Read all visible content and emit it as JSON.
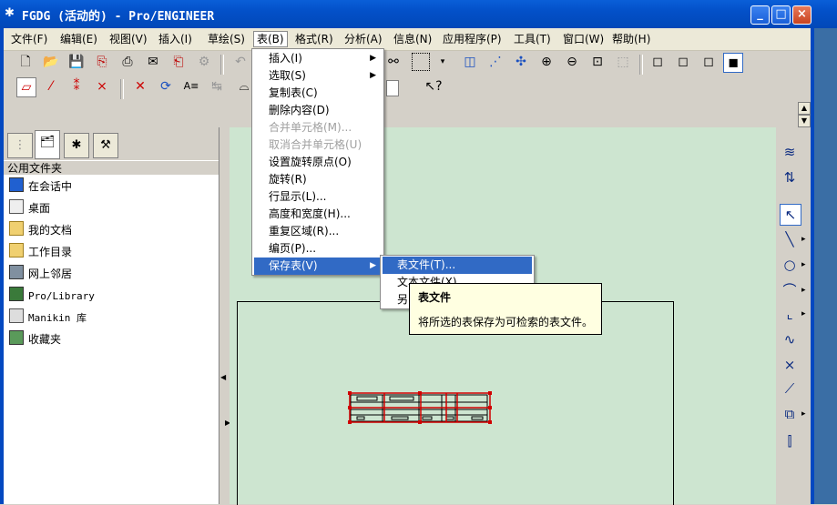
{
  "window": {
    "title": "FGDG (活动的) - Pro/ENGINEER",
    "app_icon": "proe-logo-icon",
    "controls": {
      "minimize": "_",
      "maximize": "□",
      "close": "×"
    }
  },
  "menubar": [
    {
      "label": "文件(F)"
    },
    {
      "label": "编辑(E)"
    },
    {
      "label": "视图(V)"
    },
    {
      "label": "插入(I)"
    },
    {
      "label": "草绘(S)"
    },
    {
      "label": "表(B)",
      "active": true
    },
    {
      "label": "格式(R)"
    },
    {
      "label": "分析(A)"
    },
    {
      "label": "信息(N)"
    },
    {
      "label": "应用程序(P)"
    },
    {
      "label": "工具(T)"
    },
    {
      "label": "窗口(W)"
    },
    {
      "label": "帮助(H)"
    }
  ],
  "table_menu": {
    "items": [
      {
        "label": "插入(I)",
        "submenu": true,
        "enabled": true
      },
      {
        "label": "选取(S)",
        "submenu": true,
        "enabled": true
      },
      {
        "label": "复制表(C)",
        "enabled": true
      },
      {
        "label": "删除内容(D)",
        "enabled": true
      },
      {
        "label": "合并单元格(M)...",
        "enabled": false
      },
      {
        "label": "取消合并单元格(U)",
        "enabled": false
      },
      {
        "label": "设置旋转原点(O)",
        "enabled": true
      },
      {
        "label": "旋转(R)",
        "enabled": true
      },
      {
        "label": "行显示(L)...",
        "enabled": true
      },
      {
        "label": "高度和宽度(H)...",
        "enabled": true
      },
      {
        "label": "重复区域(R)...",
        "enabled": true
      },
      {
        "label": "编页(P)...",
        "enabled": true
      },
      {
        "label": "保存表(V)",
        "submenu": true,
        "enabled": true,
        "highlighted": true
      }
    ]
  },
  "save_table_submenu": {
    "items": [
      {
        "label": "表文件(T)...",
        "highlighted": true
      },
      {
        "label": "文本文件(X)..."
      },
      {
        "label": "另"
      }
    ]
  },
  "tooltip": {
    "title": "表文件",
    "body": "将所选的表保存为可检索的表文件。"
  },
  "navigator": {
    "header": "公用文件夹",
    "folders": [
      {
        "label": "在会话中",
        "icon": "session-monitor-icon"
      },
      {
        "label": "桌面",
        "icon": "desktop-icon"
      },
      {
        "label": "我的文档",
        "icon": "my-documents-icon"
      },
      {
        "label": "工作目录",
        "icon": "working-directory-icon"
      },
      {
        "label": "网上邻居",
        "icon": "network-neighborhood-icon"
      },
      {
        "label": "Pro/Library",
        "icon": "library-icon"
      },
      {
        "label": "Manikin 库",
        "icon": "manikin-library-icon"
      },
      {
        "label": "收藏夹",
        "icon": "favorites-icon"
      }
    ]
  },
  "colors": {
    "titlebar": "#0350c8",
    "menu_highlight": "#316ac5",
    "graphics_bg": "#cde5d0",
    "table_outline": "#d00000"
  }
}
